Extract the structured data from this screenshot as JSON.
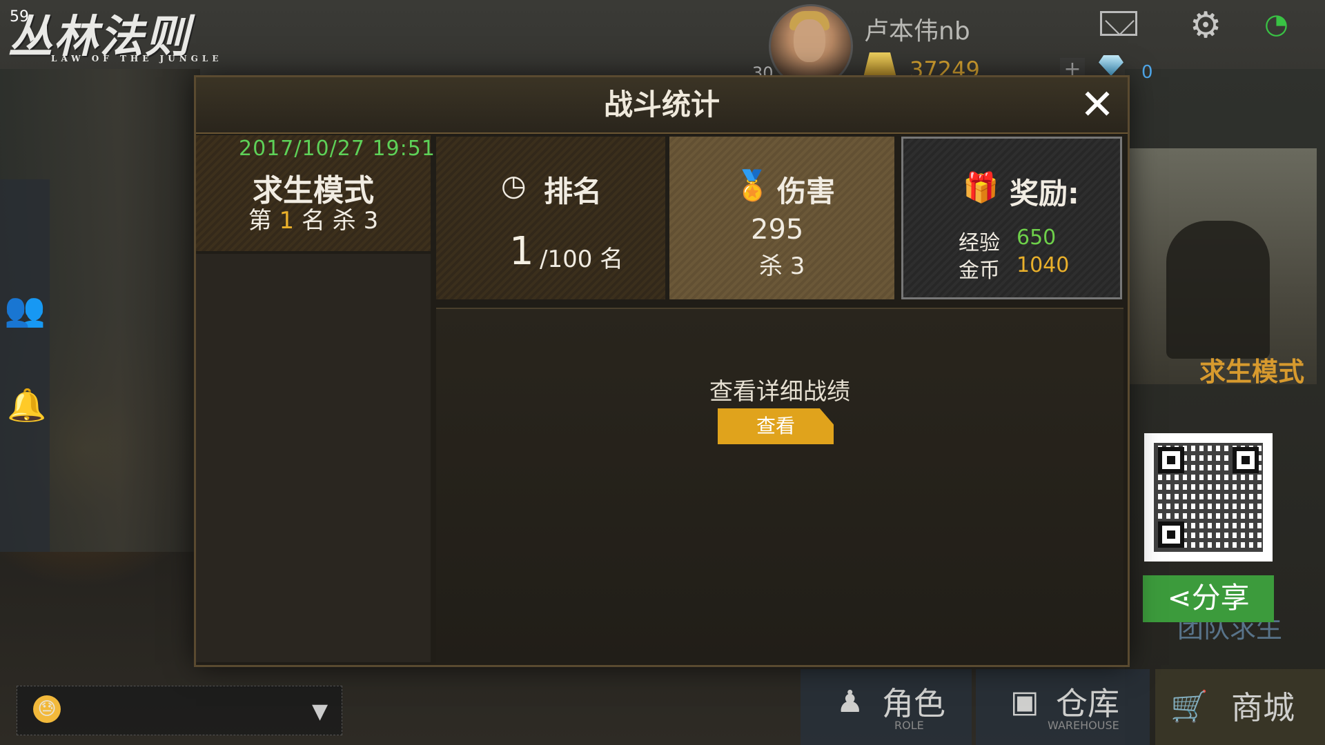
{
  "hud": {
    "fps": "59"
  },
  "logo": {
    "title": "丛林法则",
    "subtitle": "LAW OF THE JUNGLE"
  },
  "profile": {
    "username": "卢本伟nb",
    "level": "30",
    "gold": "37249",
    "diamond": "0"
  },
  "modal": {
    "title": "战斗统计",
    "left_card": {
      "timestamp": "2017/10/27 19:51",
      "mode": "求生模式",
      "rank_prefix": "第",
      "rank": "1",
      "rank_suffix": "名 杀 3"
    },
    "rank_card": {
      "title": "排名",
      "rank": "1",
      "total": "/100 名"
    },
    "damage_card": {
      "title": "伤害",
      "damage": "295",
      "kills": "杀 3"
    },
    "reward_card": {
      "title": "奖励:",
      "exp_label": "经验",
      "exp_value": "650",
      "gold_label": "金币",
      "gold_value": "1040"
    },
    "detail_text": "查看详细战绩",
    "view_button": "查看"
  },
  "side_promo": {
    "mode_label": "求生模式",
    "team_label": "团队求生",
    "share_label": "分享"
  },
  "bottom_nav": [
    {
      "label": "角色",
      "sub": "ROLE"
    },
    {
      "label": "仓库",
      "sub": "WAREHOUSE"
    },
    {
      "label": "商城",
      "sub": ""
    }
  ],
  "colors": {
    "accent_gold": "#e9b02b",
    "exp_green": "#6ed04a",
    "timestamp_green": "#5ed158",
    "share_green": "#3c9b3c"
  }
}
